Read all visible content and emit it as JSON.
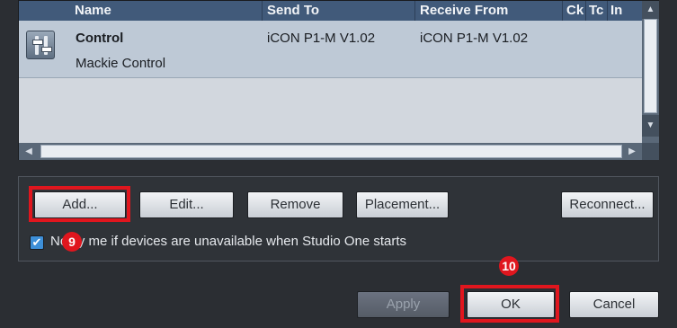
{
  "columns": {
    "name": "Name",
    "send_to": "Send To",
    "receive_from": "Receive From",
    "ck": "Ck",
    "tc": "Tc",
    "in": "In"
  },
  "devices": [
    {
      "name": "Control",
      "type": "Mackie Control",
      "send_to": "iCON P1-M V1.02",
      "receive_from": "iCON P1-M V1.02"
    }
  ],
  "buttons": {
    "add": "Add...",
    "edit": "Edit...",
    "remove": "Remove",
    "placement": "Placement...",
    "reconnect": "Reconnect...",
    "apply": "Apply",
    "ok": "OK",
    "cancel": "Cancel"
  },
  "notify": {
    "checked": true,
    "label": "Notify me if devices are unavailable when Studio One starts"
  },
  "step_markers": {
    "add": "9",
    "ok": "10"
  },
  "colors": {
    "highlight": "#e0161e",
    "header": "#415a7a",
    "checkbox": "#3d8fd8"
  }
}
